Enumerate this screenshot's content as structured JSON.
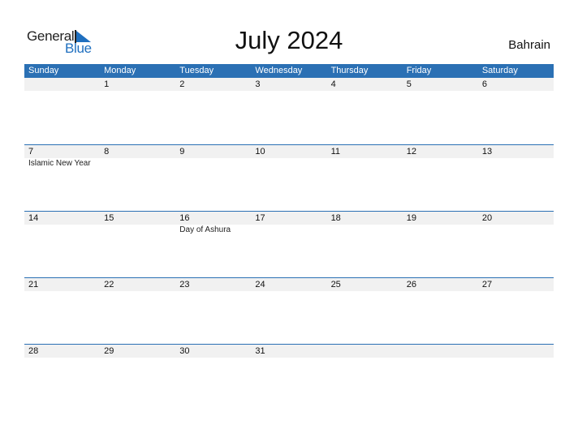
{
  "logo": {
    "text_top": "General",
    "text_bottom": "Blue",
    "brand_color": "#1f6fbf"
  },
  "title": "July 2024",
  "country": "Bahrain",
  "header_color": "#2b70b4",
  "weekdays": [
    "Sunday",
    "Monday",
    "Tuesday",
    "Wednesday",
    "Thursday",
    "Friday",
    "Saturday"
  ],
  "weeks": [
    {
      "days": [
        "",
        "1",
        "2",
        "3",
        "4",
        "5",
        "6"
      ],
      "events": [
        "",
        "",
        "",
        "",
        "",
        "",
        ""
      ]
    },
    {
      "days": [
        "7",
        "8",
        "9",
        "10",
        "11",
        "12",
        "13"
      ],
      "events": [
        "Islamic New Year",
        "",
        "",
        "",
        "",
        "",
        ""
      ]
    },
    {
      "days": [
        "14",
        "15",
        "16",
        "17",
        "18",
        "19",
        "20"
      ],
      "events": [
        "",
        "",
        "Day of Ashura",
        "",
        "",
        "",
        ""
      ]
    },
    {
      "days": [
        "21",
        "22",
        "23",
        "24",
        "25",
        "26",
        "27"
      ],
      "events": [
        "",
        "",
        "",
        "",
        "",
        "",
        ""
      ]
    },
    {
      "days": [
        "28",
        "29",
        "30",
        "31",
        "",
        "",
        ""
      ],
      "events": [
        "",
        "",
        "",
        "",
        "",
        "",
        ""
      ]
    }
  ]
}
